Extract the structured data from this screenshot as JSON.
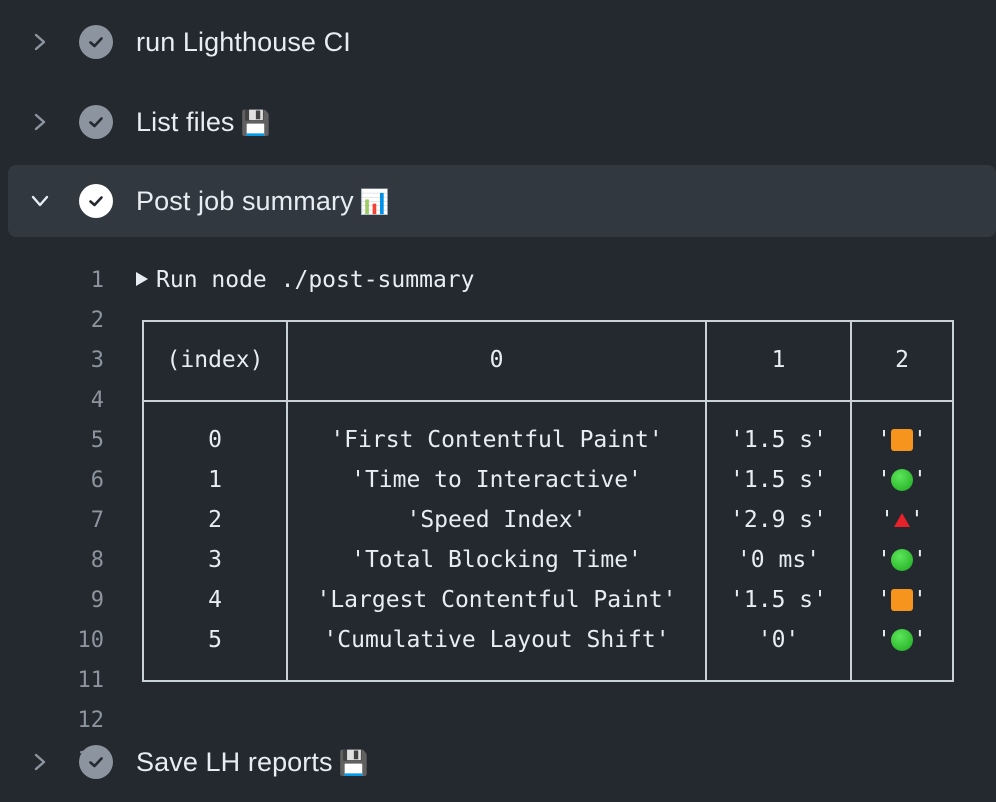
{
  "steps": [
    {
      "title": "run Lighthouse CI",
      "emoji": "",
      "state": "collapsed"
    },
    {
      "title": "List files",
      "emoji": "💾",
      "state": "collapsed"
    },
    {
      "title": "Post job summary",
      "emoji": "📊",
      "state": "expanded"
    },
    {
      "title": "Save LH reports",
      "emoji": "💾",
      "state": "collapsed"
    }
  ],
  "log": {
    "line_numbers": [
      "1",
      "2",
      "3",
      "4",
      "5",
      "6",
      "7",
      "8",
      "9",
      "10",
      "11",
      "12",
      "13"
    ],
    "command": "Run node ./post-summary",
    "table": {
      "headers": [
        "(index)",
        "0",
        "1",
        "2"
      ],
      "rows": [
        {
          "index": "0",
          "metric": "'First Contentful Paint'",
          "value": "'1.5 s'",
          "status": "orange-square"
        },
        {
          "index": "1",
          "metric": "'Time to Interactive'",
          "value": "'1.5 s'",
          "status": "green-circle"
        },
        {
          "index": "2",
          "metric": "'Speed Index'",
          "value": "'2.9 s'",
          "status": "red-triangle"
        },
        {
          "index": "3",
          "metric": "'Total Blocking Time'",
          "value": "'0 ms'",
          "status": "green-circle"
        },
        {
          "index": "4",
          "metric": "'Largest Contentful Paint'",
          "value": "'1.5 s'",
          "status": "orange-square"
        },
        {
          "index": "5",
          "metric": "'Cumulative Layout Shift'",
          "value": "'0'",
          "status": "green-circle"
        }
      ]
    }
  },
  "colors": {
    "background": "#24292f",
    "expanded_row": "#32383f",
    "status_done": "#8c959f",
    "orange": "#f7941d",
    "green": "#1ea81e",
    "red": "#e8222a"
  }
}
